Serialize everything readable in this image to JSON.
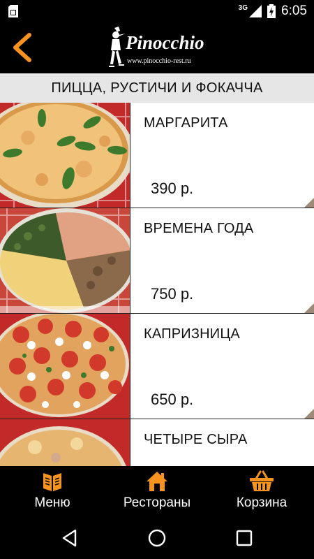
{
  "status_bar": {
    "network": "3G",
    "time": "6:05"
  },
  "header": {
    "brand": "Pinocchio",
    "site": "www.pinocchio-rest.ru"
  },
  "category": {
    "title": "ПИЦЦА, РУСТИЧИ И ФОКАЧЧА"
  },
  "items": [
    {
      "name": "МАРГАРИТА",
      "price": "390 р."
    },
    {
      "name": "ВРЕМЕНА ГОДА",
      "price": "750 р."
    },
    {
      "name": "КАПРИЗНИЦА",
      "price": "650 р."
    },
    {
      "name": "ЧЕТЫРЕ СЫРА",
      "price": ""
    }
  ],
  "bottom_nav": [
    {
      "label": "Меню",
      "icon": "menu-book-icon"
    },
    {
      "label": "Рестораны",
      "icon": "home-icon"
    },
    {
      "label": "Корзина",
      "icon": "basket-icon"
    }
  ],
  "colors": {
    "accent": "#f7931e",
    "category_bg": "#e6e6e6"
  }
}
